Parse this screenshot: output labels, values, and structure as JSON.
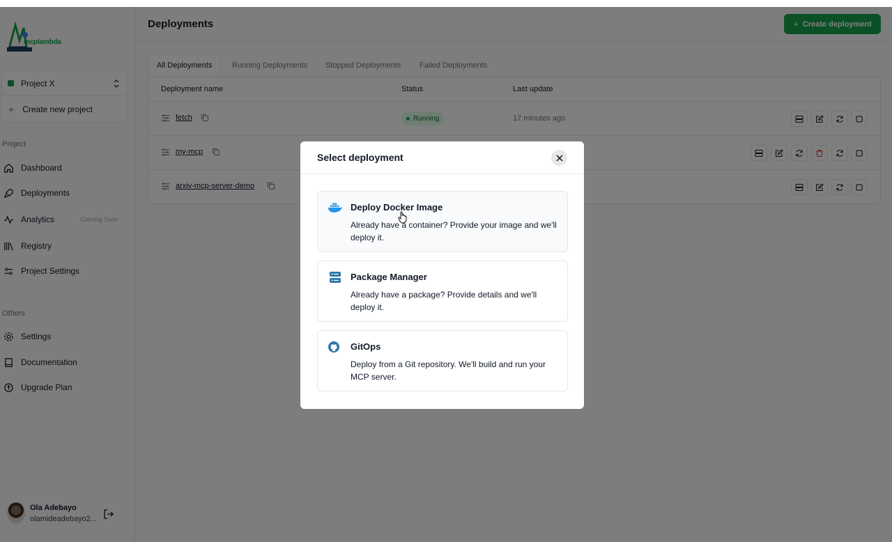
{
  "sidebar": {
    "logo_text": "mcplambda",
    "project": {
      "name": "Project X",
      "new_label": "Create new project"
    },
    "project_section": "Project",
    "nav": [
      {
        "label": "Dashboard"
      },
      {
        "label": "Deployments"
      },
      {
        "label": "Analytics",
        "badge": "Coming Soon"
      },
      {
        "label": "Registry"
      },
      {
        "label": "Project Settings"
      }
    ],
    "others_section": "Others",
    "others": [
      {
        "label": "Settings"
      },
      {
        "label": "Documentation"
      },
      {
        "label": "Upgrade Plan"
      }
    ],
    "user": {
      "name": "Ola Adebayo",
      "email": "olamideadebayo2..."
    }
  },
  "header": {
    "title": "Deployments",
    "create_button": "Create deployment"
  },
  "tabs": [
    {
      "label": "All Deployments",
      "active": true
    },
    {
      "label": "Running Deployments"
    },
    {
      "label": "Stopped Deployments"
    },
    {
      "label": "Failed Deployments"
    }
  ],
  "table": {
    "columns": [
      "Deployment name",
      "Status",
      "Last update"
    ],
    "rows": [
      {
        "name": "fetch",
        "status": "Running",
        "last_update": "17 minutes ago"
      },
      {
        "name": "my-mcp",
        "status": "",
        "last_update": ""
      },
      {
        "name": "arxiv-mcp-server-demo",
        "status": "",
        "last_update": ""
      }
    ]
  },
  "modal": {
    "title": "Select deployment",
    "options": [
      {
        "title": "Deploy Docker Image",
        "description": "Already have a container? Provide your image and we'll deploy it.",
        "icon": "docker-icon"
      },
      {
        "title": "Package Manager",
        "description": "Already have a package? Provide details and we'll deploy it.",
        "icon": "server-icon"
      },
      {
        "title": "GitOps",
        "description": "Deploy from a Git repository. We'll build and run your MCP server.",
        "icon": "github-icon"
      }
    ]
  },
  "colors": {
    "accent": "#16a34a",
    "danger": "#dc2626",
    "docker": "#2496ed"
  }
}
